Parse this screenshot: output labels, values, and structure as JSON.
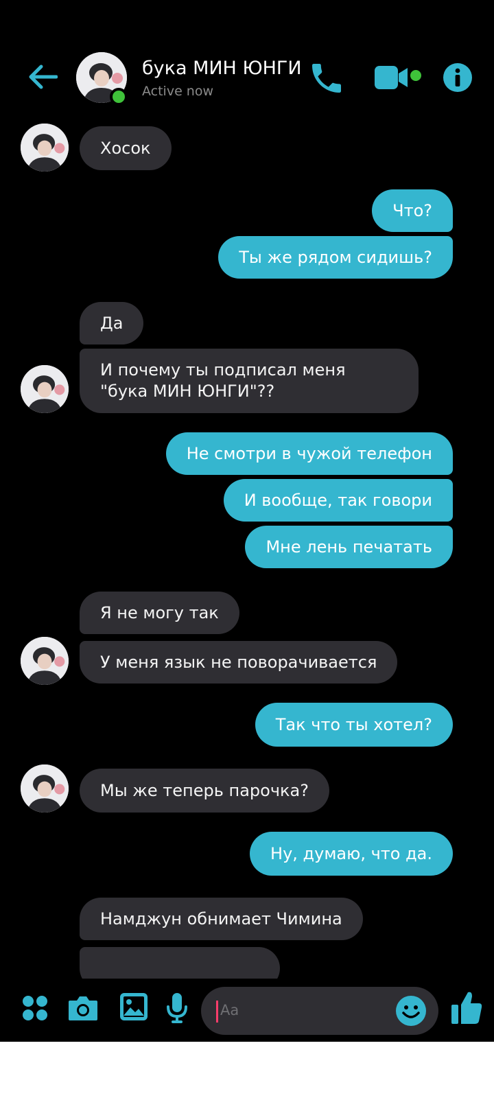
{
  "header": {
    "contact_name": "бука МИН ЮНГИ",
    "status": "Active now"
  },
  "messages": [
    {
      "side": "in",
      "text": "Хосок"
    },
    {
      "side": "out",
      "text": "Что?"
    },
    {
      "side": "out",
      "text": "Ты же рядом сидишь?"
    },
    {
      "side": "in",
      "text": "Да"
    },
    {
      "side": "in",
      "text": "И почему ты подписал меня \"бука МИН ЮНГИ\"??"
    },
    {
      "side": "out",
      "text": "Не смотри в чужой телефон"
    },
    {
      "side": "out",
      "text": "И вообще, так говори"
    },
    {
      "side": "out",
      "text": "Мне лень печатать"
    },
    {
      "side": "in",
      "text": "Я не могу так"
    },
    {
      "side": "in",
      "text": "У меня язык не поворачивается"
    },
    {
      "side": "out",
      "text": "Так что ты хотел?"
    },
    {
      "side": "in",
      "text": "Мы же теперь парочка?"
    },
    {
      "side": "out",
      "text": "Ну, думаю, что да."
    },
    {
      "side": "in",
      "text": "Намджун обнимает Чимина"
    },
    {
      "side": "in",
      "text": ""
    }
  ],
  "composer": {
    "placeholder": "Aa"
  },
  "colors": {
    "accent": "#35b6cf",
    "incoming_bubble": "#2f2e33",
    "background": "#000000",
    "online": "#3fc23a"
  },
  "icons": [
    "back-arrow-icon",
    "phone-icon",
    "video-camera-icon",
    "info-icon",
    "apps-grid-icon",
    "camera-icon",
    "gallery-icon",
    "microphone-icon",
    "emoji-icon",
    "thumbs-up-icon"
  ]
}
